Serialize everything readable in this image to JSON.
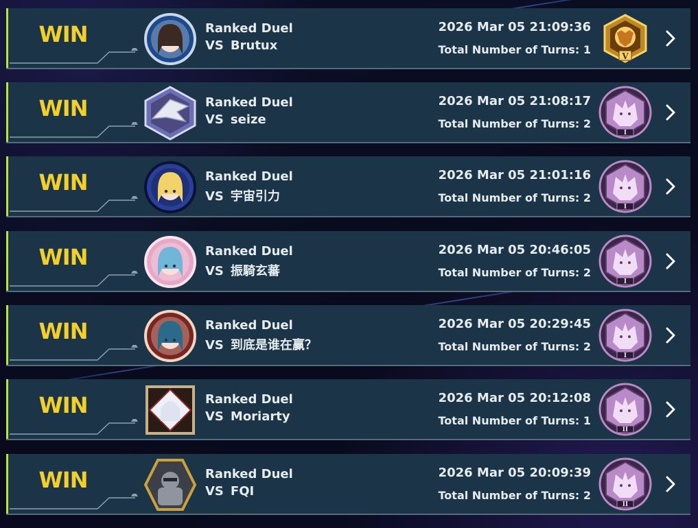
{
  "matches": [
    {
      "result": "WIN",
      "mode": "Ranked Duel",
      "vs_label": "VS",
      "opponent": "Brutux",
      "datetime": "2026 Mar 05 21:09:36",
      "turns_text": "Total Number of Turns: 1",
      "avatar_icon": "avatar-dark-haired-girl",
      "avatar_colors": [
        "#1c4a8a",
        "#c8d6ea",
        "#3a2a22"
      ],
      "rank_icon": "lion-rank-badge",
      "rank_label": "V",
      "rank_colors": [
        "#c08a22",
        "#f6d36a",
        "#6b3c0c"
      ]
    },
    {
      "result": "WIN",
      "mode": "Ranked Duel",
      "vs_label": "VS",
      "opponent": "seize",
      "datetime": "2026 Mar 05 21:08:17",
      "turns_text": "Total Number of Turns: 2",
      "avatar_icon": "avatar-blue-eyes-dragon",
      "avatar_colors": [
        "#6a6fb8",
        "#e6e8f2",
        "#4d4a80"
      ],
      "rank_icon": "wolf-rank-badge",
      "rank_label": "I",
      "rank_colors": [
        "#b98ac8",
        "#f2ddf6",
        "#5e3c6c"
      ]
    },
    {
      "result": "WIN",
      "mode": "Ranked Duel",
      "vs_label": "VS",
      "opponent": "宇宙引力",
      "datetime": "2026 Mar 05 21:01:16",
      "turns_text": "Total Number of Turns: 2",
      "avatar_icon": "avatar-cosmic-girl",
      "avatar_colors": [
        "#2a3f9a",
        "#0b1334",
        "#f1d36a"
      ],
      "rank_icon": "wolf-rank-badge",
      "rank_label": "I",
      "rank_colors": [
        "#b98ac8",
        "#f2ddf6",
        "#5e3c6c"
      ]
    },
    {
      "result": "WIN",
      "mode": "Ranked Duel",
      "vs_label": "VS",
      "opponent": "振騎玄蕃",
      "datetime": "2026 Mar 05 20:46:05",
      "turns_text": "Total Number of Turns: 2",
      "avatar_icon": "avatar-sakura-girl",
      "avatar_colors": [
        "#e7a8c6",
        "#fbe3ef",
        "#6fb6d8"
      ],
      "rank_icon": "wolf-rank-badge",
      "rank_label": "I",
      "rank_colors": [
        "#b98ac8",
        "#f2ddf6",
        "#5e3c6c"
      ]
    },
    {
      "result": "WIN",
      "mode": "Ranked Duel",
      "vs_label": "VS",
      "opponent": "到底是谁在赢？",
      "datetime": "2026 Mar 05 20:29:45",
      "turns_text": "Total Number of Turns: 2",
      "avatar_icon": "avatar-jeweled-girl",
      "avatar_colors": [
        "#7a2424",
        "#f0d8c0",
        "#2a6a8a"
      ],
      "rank_icon": "wolf-rank-badge",
      "rank_label": "I",
      "rank_colors": [
        "#b98ac8",
        "#f2ddf6",
        "#5e3c6c"
      ]
    },
    {
      "result": "WIN",
      "mode": "Ranked Duel",
      "vs_label": "VS",
      "opponent": "Moriarty",
      "datetime": "2026 Mar 05 20:12:08",
      "turns_text": "Total Number of Turns: 1",
      "avatar_icon": "avatar-silver-haired-girl",
      "avatar_colors": [
        "#c9b28a",
        "#eef0f8",
        "#8a2a2a"
      ],
      "rank_icon": "wolf-rank-badge",
      "rank_label": "II",
      "rank_colors": [
        "#b98ac8",
        "#f2ddf6",
        "#5e3c6c"
      ]
    },
    {
      "result": "WIN",
      "mode": "Ranked Duel",
      "vs_label": "VS",
      "opponent": "FQI",
      "datetime": "2026 Mar 05 20:09:39",
      "turns_text": "Total Number of Turns: 2",
      "avatar_icon": "avatar-armored-knight",
      "avatar_colors": [
        "#c9a23a",
        "#3c3f48",
        "#8f949e"
      ],
      "rank_icon": "wolf-rank-badge",
      "rank_label": "II",
      "rank_colors": [
        "#b98ac8",
        "#f2ddf6",
        "#5e3c6c"
      ]
    }
  ],
  "colors": {
    "win": "#f3cf2b",
    "row_bg": "#1b3447",
    "accent_bar": "#b6ea2a",
    "text": "#e6ecef"
  }
}
